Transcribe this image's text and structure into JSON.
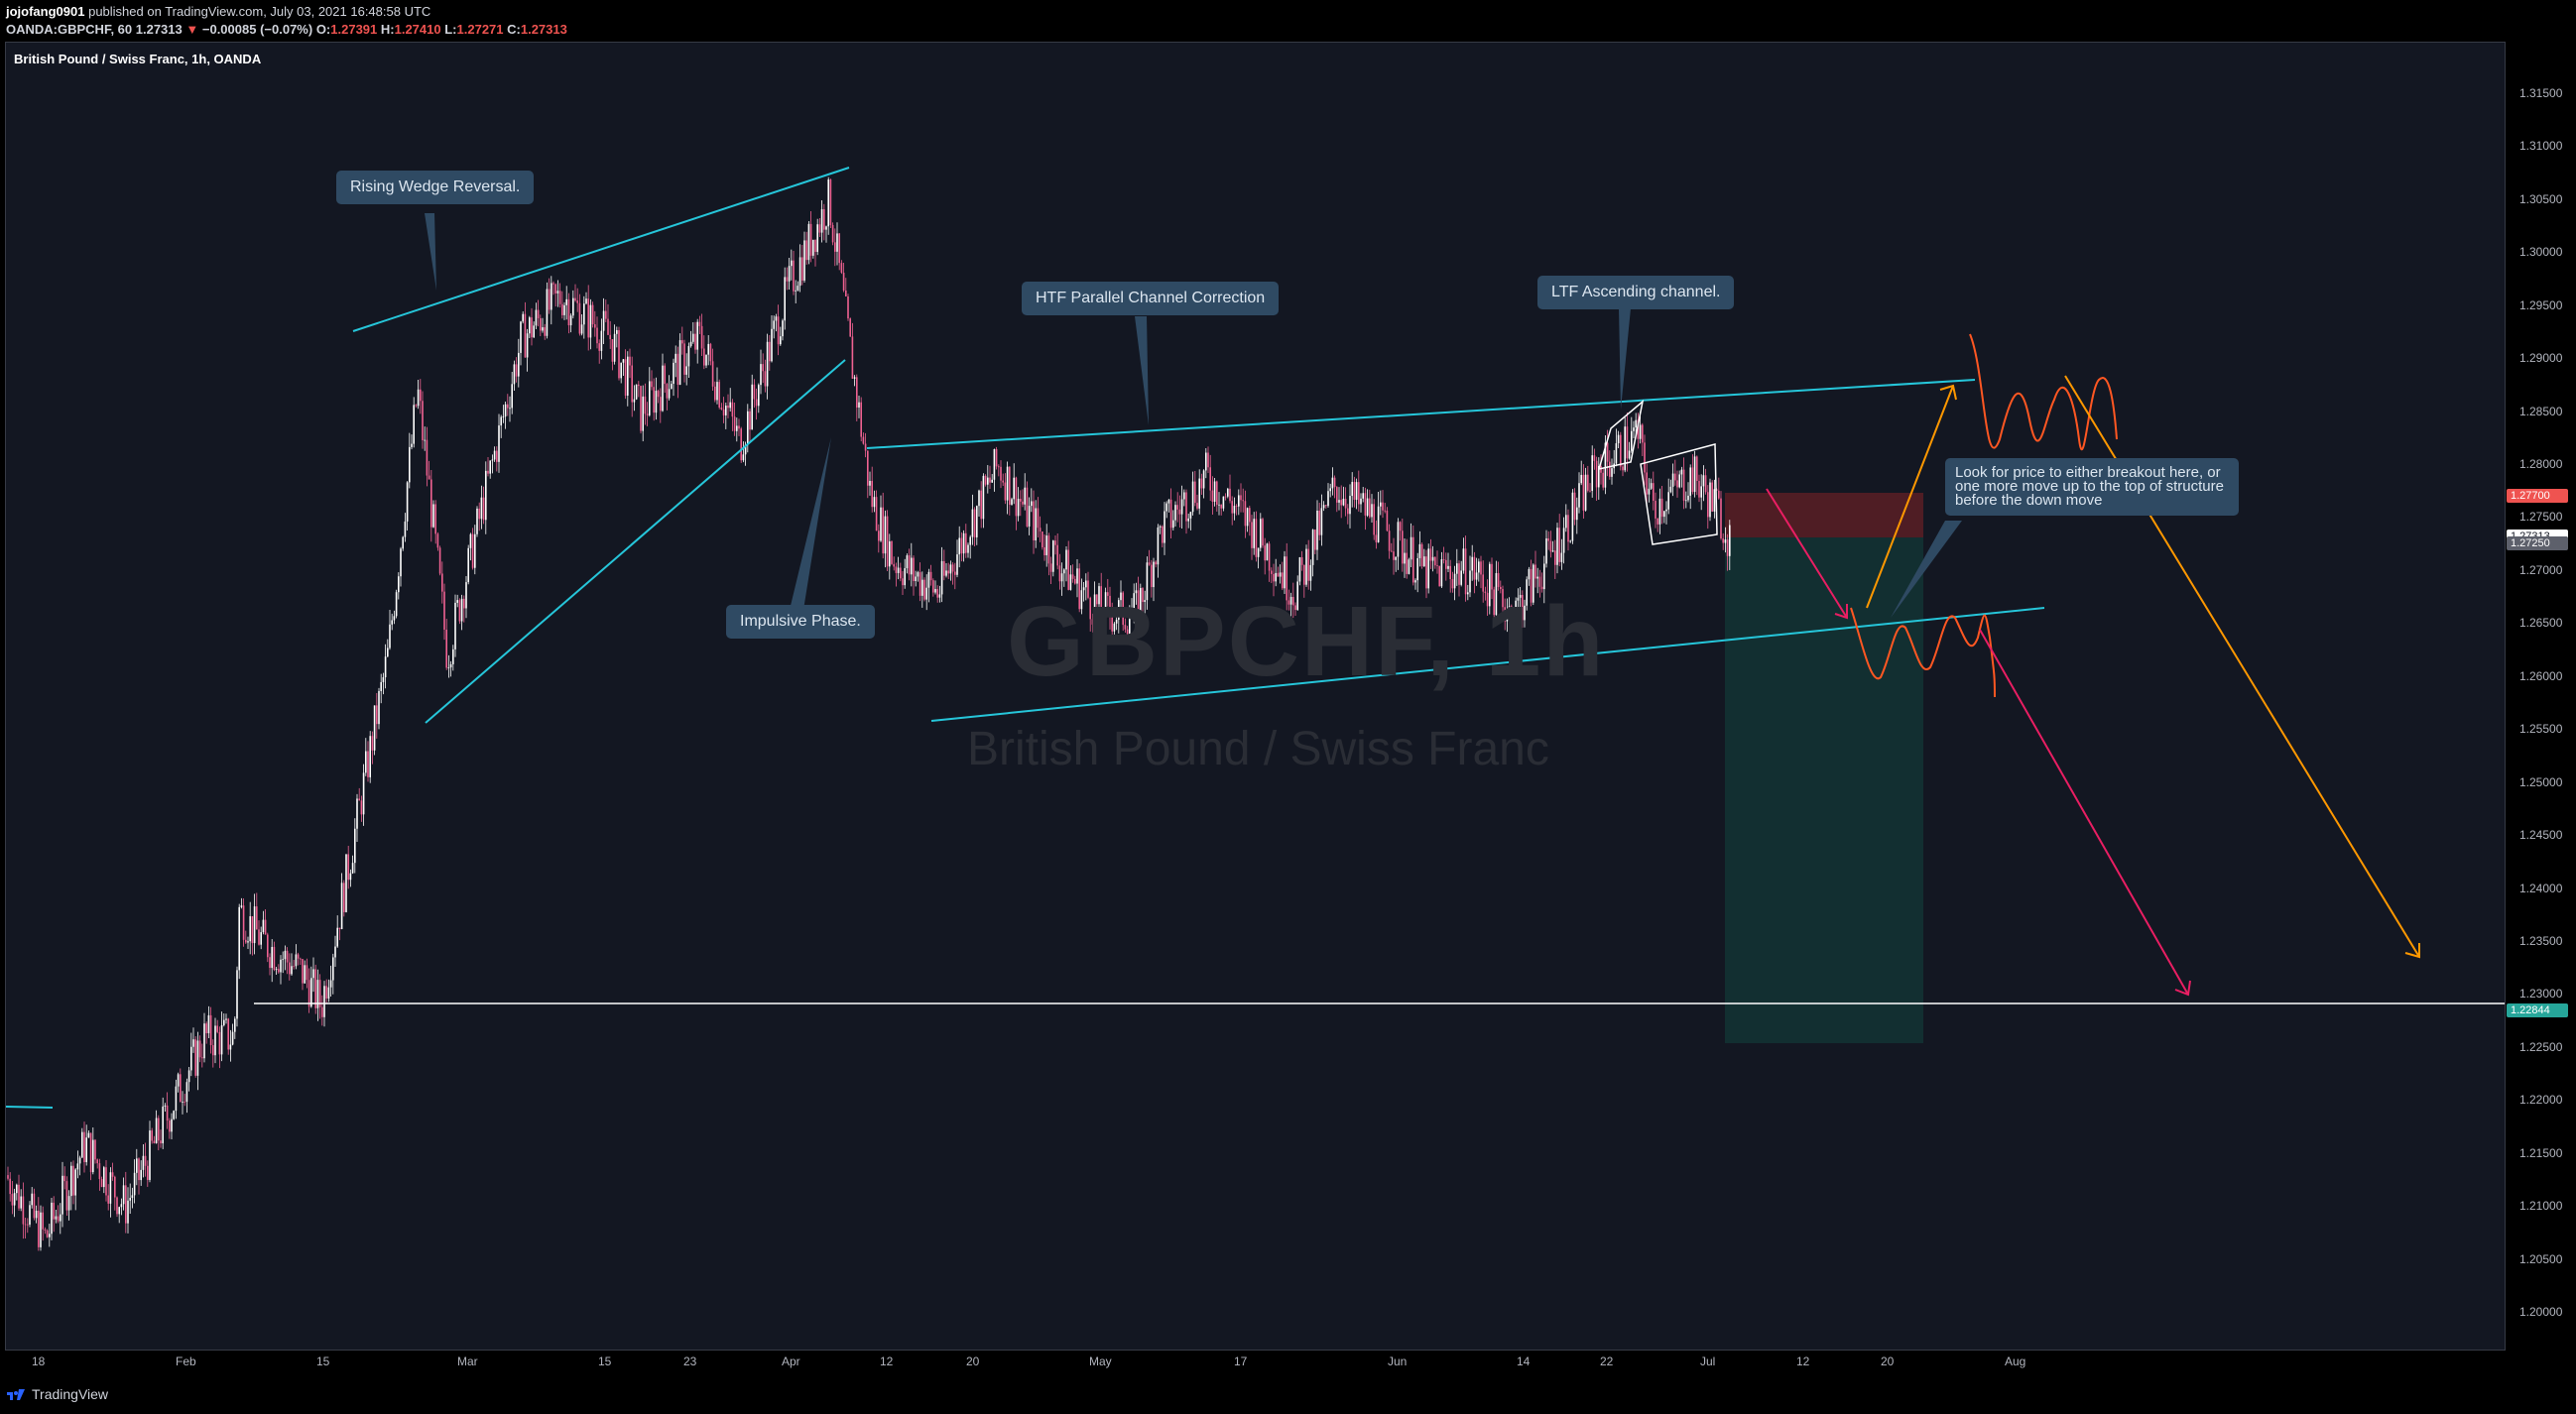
{
  "header": {
    "publisher_user": "jojofang0901",
    "publisher_text": "published on TradingView.com, July 03, 2021 16:48:58 UTC",
    "symbol_line": "OANDA:GBPCHF, 60",
    "last_price": "1.27313",
    "change": "−0.00085 (−0.07%)",
    "o_label": "O:",
    "o_value": "1.27391",
    "h_label": "H:",
    "h_value": "1.27410",
    "l_label": "L:",
    "l_value": "1.27271",
    "c_label": "C:",
    "c_value": "1.27313"
  },
  "chart": {
    "symbol_label": "British Pound / Swiss Franc, 1h, OANDA",
    "watermark_symbol": "GBPCHF, 1h",
    "watermark_name": "British Pound / Swiss Franc",
    "price_min": 1.195,
    "price_max": 1.318,
    "price_ticks": [
      "1.31500",
      "1.31000",
      "1.30500",
      "1.30000",
      "1.29500",
      "1.29000",
      "1.28500",
      "1.28000",
      "1.27500",
      "1.27000",
      "1.26500",
      "1.26000",
      "1.25500",
      "1.25000",
      "1.24500",
      "1.24000",
      "1.23500",
      "1.23000",
      "1.22500",
      "1.22000",
      "1.21500",
      "1.21000",
      "1.20500",
      "1.20000"
    ],
    "price_badges": [
      {
        "text": "1.27700",
        "value": 1.277,
        "bg": "#ef5350",
        "fg": "#ffffff"
      },
      {
        "text": "1.27313",
        "value": 1.27313,
        "bg": "#ffffff",
        "fg": "#131722"
      },
      {
        "text": "1.27250",
        "value": 1.2725,
        "bg": "#5d606b",
        "fg": "#ffffff"
      },
      {
        "text": "1.22844",
        "value": 1.22844,
        "bg": "#26a69a",
        "fg": "#ffffff"
      }
    ],
    "time_ticks": [
      "18",
      "Feb",
      "15",
      "Mar",
      "15",
      "23",
      "Apr",
      "12",
      "20",
      "May",
      "17",
      "Jun",
      "14",
      "22",
      "Jul",
      "12",
      "20",
      "Aug"
    ],
    "colors": {
      "background": "#131722",
      "candle": "#f06292",
      "trendline": "#26c6da",
      "support": "#ffffff",
      "orange": "#ff9800",
      "red_path": "#ff5722",
      "pink_arrow": "#e91e63",
      "stop_zone": "#5b1f24",
      "target_zone": "#123a38"
    }
  },
  "callouts": {
    "rising_wedge": "Rising Wedge Reversal.",
    "htf_channel": "HTF Parallel Channel Correction",
    "ltf_channel": "LTF Ascending channel.",
    "impulsive": "Impulsive Phase.",
    "look_for": "Look for price to either breakout here, or one more move up to the top of structure before the down move"
  },
  "footer": {
    "brand": "TradingView"
  }
}
